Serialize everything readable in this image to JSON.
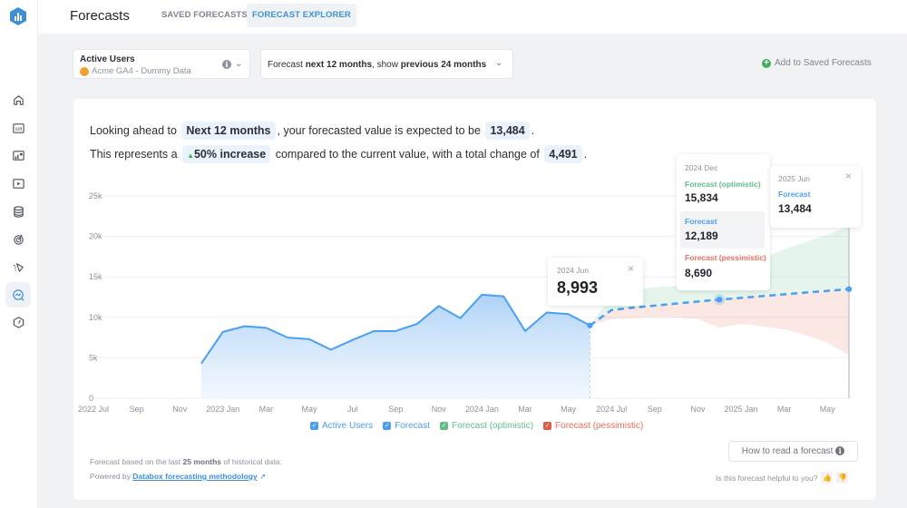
{
  "app": {
    "title": "Forecasts",
    "tabs": [
      {
        "label": "SAVED FORECASTS",
        "active": false
      },
      {
        "label": "FORECAST EXPLORER",
        "active": true
      }
    ],
    "logo_color": "#3f8fd8",
    "sidebar_icons": [
      "home-icon",
      "numbers-icon",
      "dashboard-icon",
      "video-icon",
      "database-icon",
      "goals-icon",
      "alerts-icon",
      "forecast-icon",
      "performance-icon"
    ],
    "sidebar_active": "forecast-icon"
  },
  "controls": {
    "metric_name": "Active Users",
    "metric_source": "Acme GA4 - Dummy Data",
    "range_prefix": "Forecast ",
    "range_forecast": "next 12 months",
    "range_mid": ", show ",
    "range_previous": "previous 24 months",
    "add_saved_label": "Add to Saved Forecasts"
  },
  "summary": {
    "line1_prefix": "Looking ahead to",
    "period": "Next 12 months",
    "line1_mid": ", your forecasted value is expected to be",
    "forecast_value": "13,484",
    "line1_suffix": ".",
    "line2_prefix": "This represents a",
    "change_pct": "50% increase",
    "line2_mid": "compared to the current value, with a total change of",
    "total_change": "4,491",
    "line2_suffix": "."
  },
  "tooltips": {
    "current": {
      "date": "2024 Jun",
      "value": "8,993"
    },
    "mid": {
      "date": "2024 Dec",
      "optimistic_label": "Forecast (optimistic)",
      "optimistic_value": "15,834",
      "forecast_label": "Forecast",
      "forecast_value": "12,189",
      "pessimistic_label": "Forecast (pessimistic)",
      "pessimistic_value": "8,690"
    },
    "end": {
      "date": "2025 Jun",
      "forecast_label": "Forecast",
      "forecast_value": "13,484"
    }
  },
  "footer": {
    "based_prefix": "Forecast based on the last ",
    "based_months": "25 months",
    "based_suffix": " of historical data.",
    "powered_prefix": "Powered by ",
    "powered_link": "Databox forecasting methodology",
    "how_to_read": "How to read a forecast",
    "helpful_question": "Is this forecast helpful to you?"
  },
  "chart_data": {
    "type": "area",
    "title": "",
    "xlabel": "",
    "ylabel": "",
    "ylim": [
      0,
      25000
    ],
    "yticks": [
      0,
      5000,
      10000,
      15000,
      20000,
      25000
    ],
    "ytick_labels": [
      "0",
      "5k",
      "10k",
      "15k",
      "20k",
      "25k"
    ],
    "x_months": [
      "2022 Jul",
      "2022 Aug",
      "2022 Sep",
      "2022 Oct",
      "2022 Nov",
      "2022 Dec",
      "2023 Jan",
      "2023 Feb",
      "2023 Mar",
      "2023 Apr",
      "2023 May",
      "2023 Jun",
      "2023 Jul",
      "2023 Aug",
      "2023 Sep",
      "2023 Oct",
      "2023 Nov",
      "2023 Dec",
      "2024 Jan",
      "2024 Feb",
      "2024 Mar",
      "2024 Apr",
      "2024 May",
      "2024 Jun",
      "2024 Jul",
      "2024 Aug",
      "2024 Sep",
      "2024 Oct",
      "2024 Nov",
      "2024 Dec",
      "2025 Jan",
      "2025 Feb",
      "2025 Mar",
      "2025 Apr",
      "2025 May",
      "2025 Jun"
    ],
    "xtick_labels": [
      {
        "index": 0,
        "label": "2022 Jul"
      },
      {
        "index": 2,
        "label": "Sep"
      },
      {
        "index": 4,
        "label": "Nov"
      },
      {
        "index": 6,
        "label": "2023 Jan"
      },
      {
        "index": 8,
        "label": "Mar"
      },
      {
        "index": 10,
        "label": "May"
      },
      {
        "index": 12,
        "label": "Jul"
      },
      {
        "index": 14,
        "label": "Sep"
      },
      {
        "index": 16,
        "label": "Nov"
      },
      {
        "index": 18,
        "label": "2024 Jan"
      },
      {
        "index": 20,
        "label": "Mar"
      },
      {
        "index": 22,
        "label": "May"
      },
      {
        "index": 24,
        "label": "2024 Jul"
      },
      {
        "index": 26,
        "label": "Sep"
      },
      {
        "index": 28,
        "label": "Nov"
      },
      {
        "index": 30,
        "label": "2025 Jan"
      },
      {
        "index": 32,
        "label": "Mar"
      },
      {
        "index": 34,
        "label": "May"
      }
    ],
    "grid": true,
    "legend_position": "bottom",
    "series": [
      {
        "name": "Active Users",
        "color": "#4a9ff0",
        "start_index": 5,
        "values": [
          4300,
          8200,
          8900,
          8700,
          7500,
          7300,
          6000,
          7200,
          8300,
          8300,
          9200,
          11400,
          9900,
          12800,
          12600,
          8300,
          10600,
          10400,
          8993
        ]
      },
      {
        "name": "Forecast",
        "color": "#4a9ff0",
        "start_index": 23,
        "values": [
          8993,
          10900,
          11200,
          11450,
          11700,
          11950,
          12189,
          12400,
          12620,
          12840,
          13060,
          13270,
          13484
        ]
      },
      {
        "name": "Forecast (optimistic)",
        "color": "#5fbf86",
        "start_index": 23,
        "values": [
          8993,
          12600,
          13400,
          13700,
          13900,
          14700,
          15834,
          16500,
          17300,
          18400,
          19300,
          20200,
          21300
        ]
      },
      {
        "name": "Forecast (pessimistic)",
        "color": "#e8705f",
        "start_index": 23,
        "values": [
          8993,
          9800,
          9900,
          10000,
          10000,
          9800,
          8690,
          9200,
          8900,
          8500,
          7800,
          6900,
          5300
        ]
      }
    ],
    "highlight_points": [
      {
        "index": 23,
        "value": 8993
      },
      {
        "index": 29,
        "value": 12189
      },
      {
        "index": 35,
        "value": 13484
      }
    ]
  }
}
